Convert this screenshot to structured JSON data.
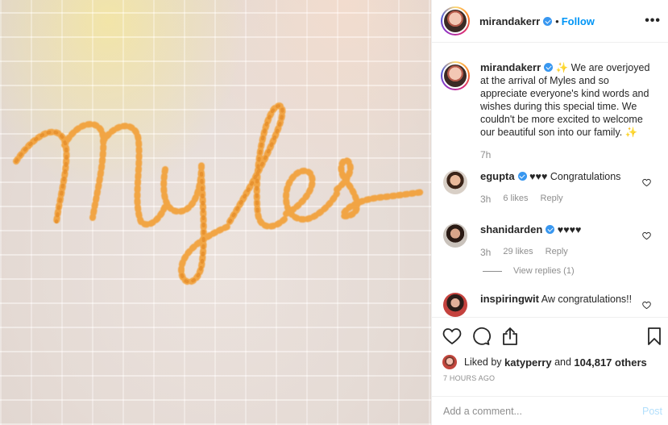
{
  "header": {
    "username": "mirandakerr",
    "separator": "•",
    "follow_label": "Follow",
    "more_label": "•••"
  },
  "caption": {
    "username": "mirandakerr",
    "text": "✨ We are overjoyed at the arrival of Myles and so appreciate everyone's kind words and wishes during this special time. We couldn't be more excited to welcome our beautiful son into our family. ✨",
    "time": "7h"
  },
  "photo": {
    "embroidered_text": "Myles",
    "thread_color": "#f2a23c"
  },
  "comments": [
    {
      "username": "egupta",
      "text": "♥♥♥ Congratulations",
      "time": "3h",
      "likes": "6 likes",
      "reply": "Reply"
    },
    {
      "username": "shanidarden",
      "text": "♥♥♥♥",
      "time": "3h",
      "likes": "29 likes",
      "reply": "Reply",
      "view_replies": "View replies (1)"
    },
    {
      "username": "inspiringwit",
      "text": "Aw congratulations!!"
    }
  ],
  "likes": {
    "prefix": "Liked by",
    "user": "katyperry",
    "middle": "and",
    "others": "104,817 others"
  },
  "posted_time": "7 HOURS AGO",
  "add_comment": {
    "placeholder": "Add a comment...",
    "post_label": "Post"
  },
  "icons": {
    "like": "heart-icon",
    "comment": "comment-icon",
    "share": "share-icon",
    "save": "bookmark-icon",
    "verified": "verified-badge-icon",
    "comment_like": "heart-icon"
  },
  "colors": {
    "link_blue": "#0095f6",
    "verified_blue": "#3897f0",
    "muted": "#8e8e8e",
    "post_disabled": "#b2dffc"
  }
}
